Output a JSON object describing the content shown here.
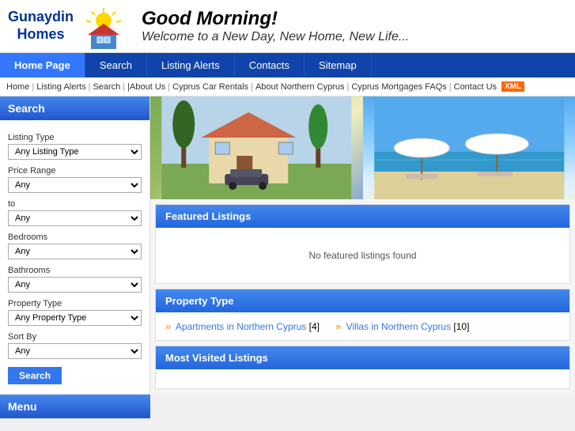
{
  "header": {
    "logo_line1": "Gunaydin",
    "logo_line2": "Homes",
    "greeting_main": "Good Morning!",
    "greeting_sub": "Welcome to a New Day, New Home, New Life..."
  },
  "nav": {
    "items": [
      {
        "label": "Home Page",
        "active": true
      },
      {
        "label": "Search",
        "active": false
      },
      {
        "label": "Listing Alerts",
        "active": false
      },
      {
        "label": "Contacts",
        "active": false
      },
      {
        "label": "Sitemap",
        "active": false
      }
    ]
  },
  "breadcrumb": {
    "items": [
      "Home",
      "Listing Alerts",
      "Search",
      "",
      "About Us",
      "Cyprus Car Rentals",
      "About Northern Cyprus",
      "Cyprus Mortgages FAQs",
      "Contact Us"
    ],
    "xml_label": "XML"
  },
  "sidebar": {
    "search_title": "Search",
    "menu_title": "Menu",
    "search_btn": "Search",
    "listing_type_label": "Listing Type",
    "listing_type_default": "Any Listing Type",
    "price_range_label": "Price Range",
    "price_range_default": "Any",
    "price_range_to": "to",
    "price_range_to_default": "Any",
    "bedrooms_label": "Bedrooms",
    "bedrooms_default": "Any",
    "bathrooms_label": "Bathrooms",
    "bathrooms_default": "Any",
    "property_type_label": "Property Type",
    "property_type_default": "Any Property Type",
    "sort_by_label": "Sort By",
    "sort_by_default": "Any"
  },
  "featured": {
    "title": "Featured Listings",
    "empty_msg": "No featured listings found"
  },
  "property_type": {
    "title": "Property Type",
    "items": [
      {
        "label": "Apartments in Northern Cyprus",
        "count": "[4]"
      },
      {
        "label": "Villas in Northern Cyprus",
        "count": "[10]"
      }
    ]
  },
  "most_visited": {
    "title": "Most Visited Listings"
  }
}
